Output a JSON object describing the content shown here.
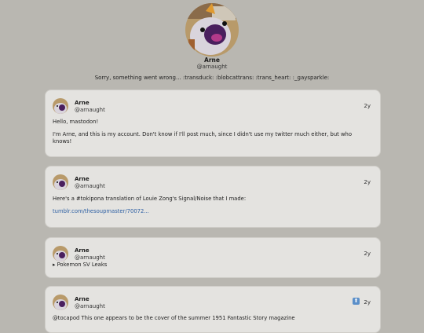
{
  "profile": {
    "name": "Arne",
    "handle": "@arnaught",
    "error_message": "Sorry, something went wrong... :transduck: :blobcattrans: :trans_heart: :_gaysparkle:"
  },
  "posts": [
    {
      "name": "Arne",
      "handle": "@arnaught",
      "time": "2y",
      "paragraphs": [
        "Hello, mastodon!",
        "I'm Arne, and this is my account. Don't know if I'll post much, since I didn't use my twitter much either, but who knows!"
      ]
    },
    {
      "name": "Arne",
      "handle": "@arnaught",
      "time": "2y",
      "text": "Here's a #tokipona translation of Louie Zong's Signal/Noise that I made:",
      "link": "tumblr.com/thesoupmaster/70072..."
    },
    {
      "name": "Arne",
      "handle": "@arnaught",
      "time": "2y",
      "summary": "▸ Pokemon SV Leaks"
    },
    {
      "name": "Arne",
      "handle": "@arnaught",
      "time": "2y",
      "boost_icon": "boost-icon",
      "text": "@tocapod This one appears to be the cover of the summer 1951 Fantastic Story magazine"
    }
  ],
  "colors": {
    "background": "#b9b7b1",
    "card": "#e4e3e0",
    "link": "#2d5fa3"
  }
}
